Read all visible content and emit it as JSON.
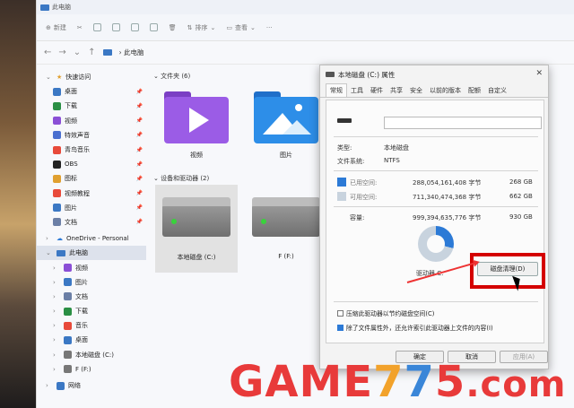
{
  "window": {
    "title": "此电脑"
  },
  "toolbar": {
    "new_label": "新建",
    "sort_label": "排序",
    "view_label": "查看"
  },
  "address": {
    "crumb": "此电脑"
  },
  "sidebar": {
    "quick_access": "快速访问",
    "items": [
      {
        "label": "桌面",
        "color": "#3b78c4"
      },
      {
        "label": "下载",
        "color": "#2a8f44"
      },
      {
        "label": "视频",
        "color": "#8b4fd6"
      },
      {
        "label": "特效声音",
        "color": "#4a6fd0"
      },
      {
        "label": "青鸟音乐",
        "color": "#e84a3a"
      },
      {
        "label": "OBS",
        "color": "#222222"
      },
      {
        "label": "图标",
        "color": "#e0a030"
      },
      {
        "label": "视频教程",
        "color": "#e84a3a"
      },
      {
        "label": "图片",
        "color": "#3b78c4"
      },
      {
        "label": "文档",
        "color": "#6b7fa6"
      }
    ],
    "onedrive": "OneDrive - Personal",
    "this_pc": "此电脑",
    "pc_items": [
      {
        "label": "视频",
        "color": "#8b4fd6"
      },
      {
        "label": "图片",
        "color": "#3b78c4"
      },
      {
        "label": "文档",
        "color": "#6b7fa6"
      },
      {
        "label": "下载",
        "color": "#2a8f44"
      },
      {
        "label": "音乐",
        "color": "#e84a3a"
      },
      {
        "label": "桌面",
        "color": "#3b78c4"
      },
      {
        "label": "本地磁盘 (C:)",
        "color": "#777777"
      },
      {
        "label": "F (F:)",
        "color": "#777777"
      }
    ],
    "network": "网络"
  },
  "content": {
    "folders_header": "文件夹 (6)",
    "folders": [
      {
        "label": "视频"
      },
      {
        "label": "图片"
      }
    ],
    "drives_header": "设备和驱动器 (2)",
    "drives": [
      {
        "label": "本地磁盘 (C:)"
      },
      {
        "label": "F (F:)"
      }
    ]
  },
  "dialog": {
    "title": "本地磁盘 (C:) 属性",
    "tabs": [
      "常规",
      "工具",
      "硬件",
      "共享",
      "安全",
      "以前的版本",
      "配额",
      "自定义"
    ],
    "type_label": "类型:",
    "type_value": "本地磁盘",
    "fs_label": "文件系统:",
    "fs_value": "NTFS",
    "used_label": "已用空间:",
    "used_bytes": "288,054,161,408 字节",
    "used_gb": "268 GB",
    "free_label": "可用空间:",
    "free_bytes": "711,340,474,368 字节",
    "free_gb": "662 GB",
    "cap_label": "容量:",
    "cap_bytes": "999,394,635,776 字节",
    "cap_gb": "930 GB",
    "used_fraction": 0.29,
    "drive_label": "驱动器 C:",
    "cleanup_label": "磁盘清理(D)",
    "compress_label": "压缩此驱动器以节约磁盘空间(C)",
    "index_label": "除了文件属性外，还允许索引此驱动器上文件的内容(I)",
    "ok_label": "确定",
    "cancel_label": "取消",
    "apply_label": "应用(A)"
  },
  "colors": {
    "used": "#2c7ad6",
    "free": "#c8d3de",
    "highlight": "#d40000"
  },
  "watermark": {
    "a": "GAME",
    "b": "7",
    "c": "7",
    "d": "5",
    "e": ".com"
  }
}
